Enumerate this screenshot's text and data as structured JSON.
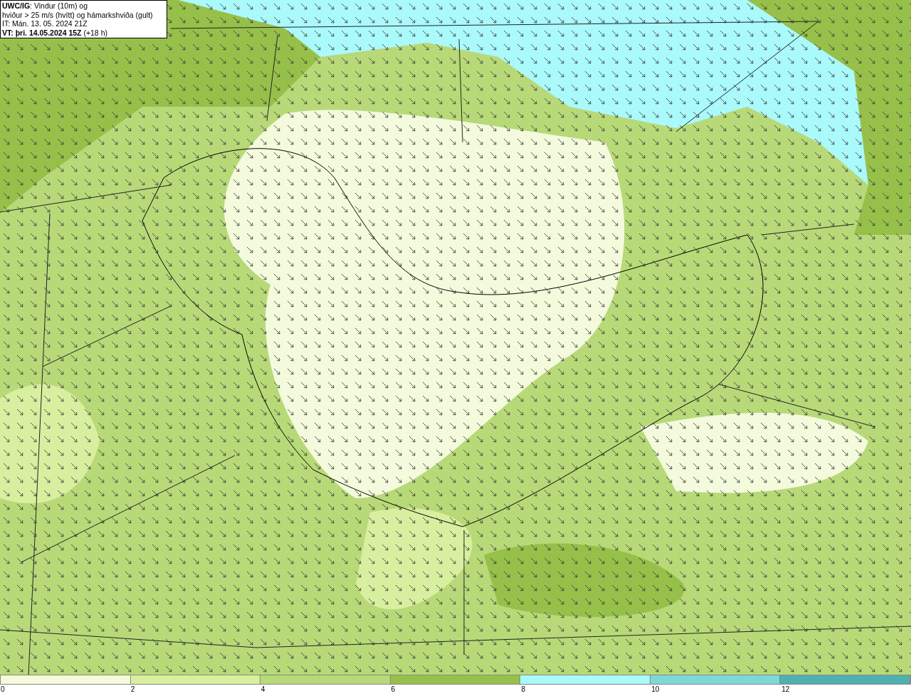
{
  "title_box": {
    "lines": [
      "**UWC/IG**: Vindur (10m) og",
      "hviður > 25 m/s (hvítt) og hámarkshviða (gult)",
      "IT: Mán. 13. 05. 2024 21Z",
      "**VT: þri. 14.05.2024 15Z** (+18 h)"
    ]
  },
  "colorbar": {
    "segments": [
      {
        "color": "#f3fbdc"
      },
      {
        "color": "#d9efa0"
      },
      {
        "color": "#b8d978"
      },
      {
        "color": "#97c04a"
      },
      {
        "color": "#aaf9fb"
      },
      {
        "color": "#7fd8d8"
      },
      {
        "color": "#4fb0b0"
      }
    ],
    "ticks": [
      "0",
      "2",
      "4",
      "6",
      "8",
      "10",
      "12"
    ]
  }
}
